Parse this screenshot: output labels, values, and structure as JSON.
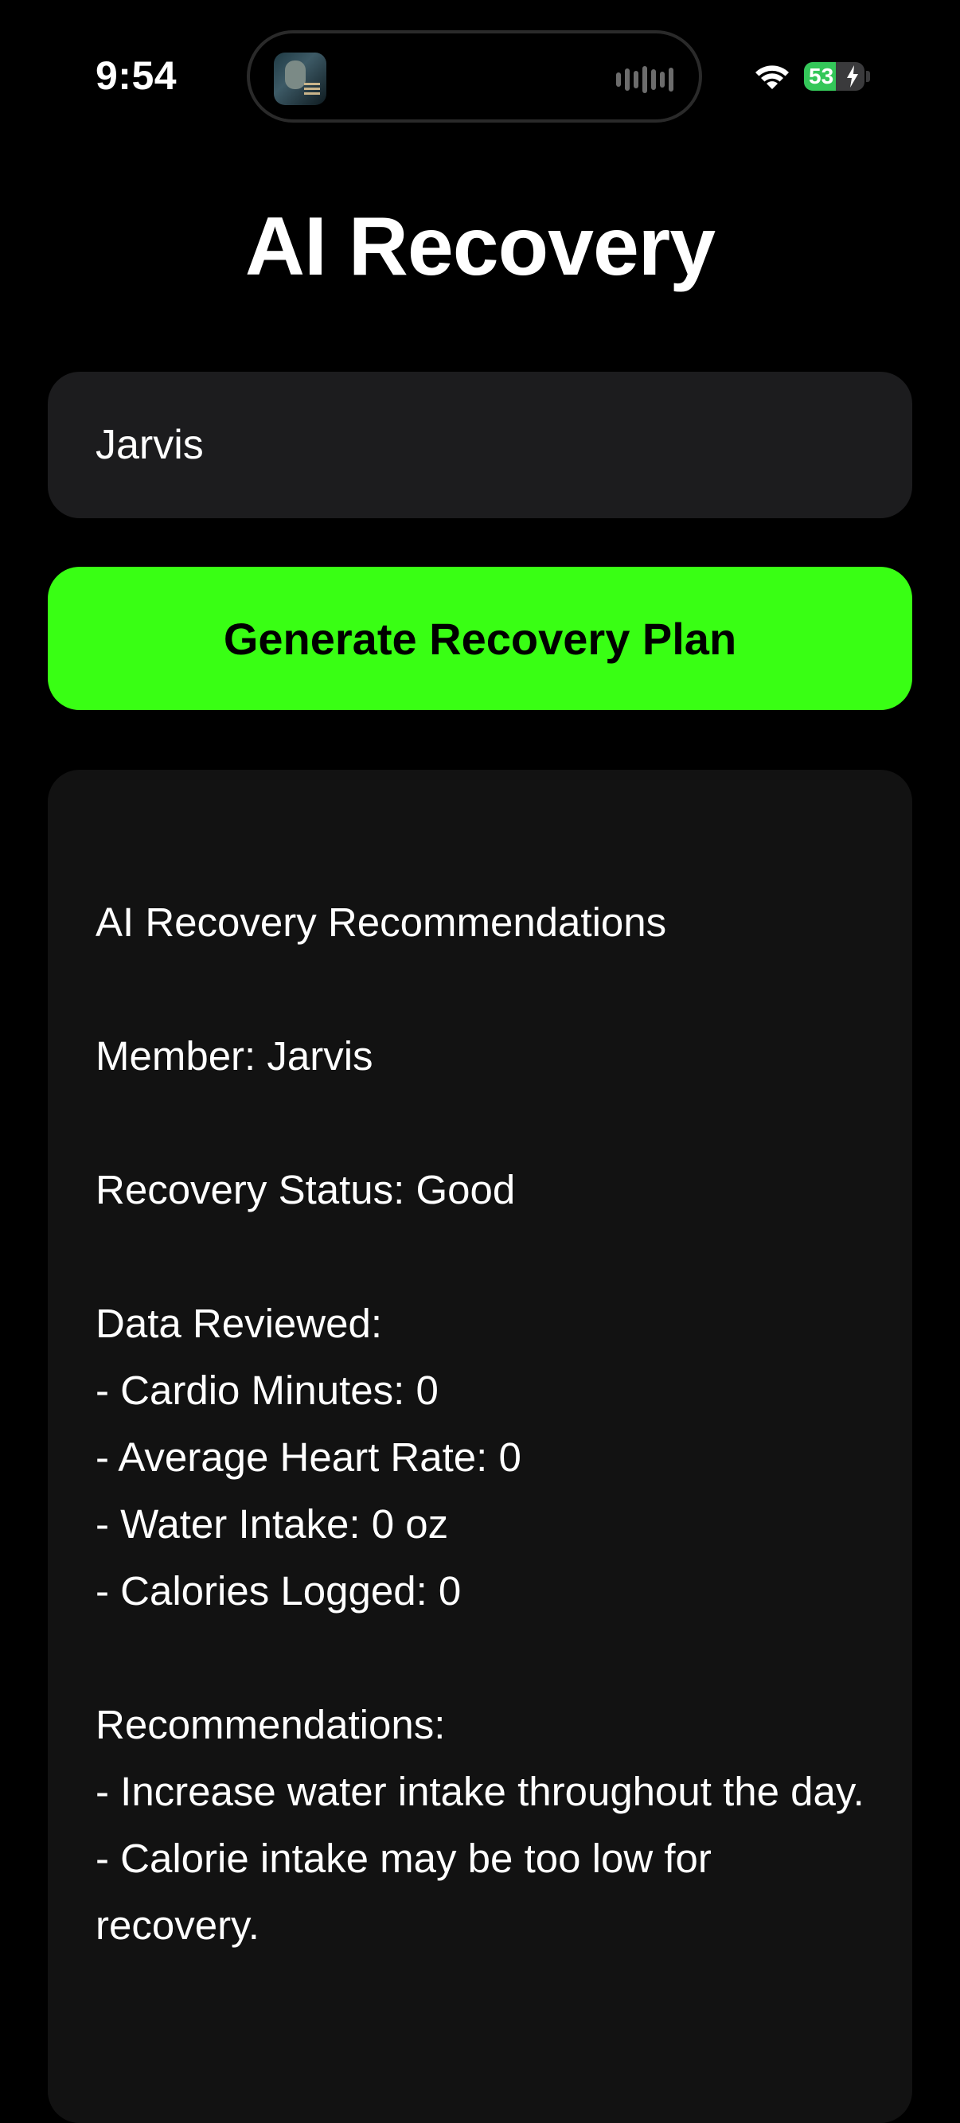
{
  "status_bar": {
    "time": "9:54",
    "battery_level": "53",
    "battery_charging": true
  },
  "title": "AI Recovery",
  "name_input": {
    "value": "Jarvis"
  },
  "generate_button": {
    "label": "Generate Recovery Plan"
  },
  "colors": {
    "accent": "#39ff14",
    "background": "#000000",
    "field": "#1c1c1e",
    "card": "#121212",
    "battery": "#34c759"
  },
  "results": {
    "heading": "AI Recovery Recommendations",
    "member": "Member: Jarvis",
    "status": "Recovery Status: Good",
    "data_heading": "Data Reviewed:",
    "data_items": [
      "- Cardio Minutes: 0",
      "- Average Heart Rate: 0",
      "- Water Intake: 0 oz",
      "- Calories Logged: 0"
    ],
    "rec_heading": "Recommendations:",
    "rec_items": [
      "- Increase water intake throughout the day.",
      "- Calorie intake may be too low for recovery."
    ]
  }
}
